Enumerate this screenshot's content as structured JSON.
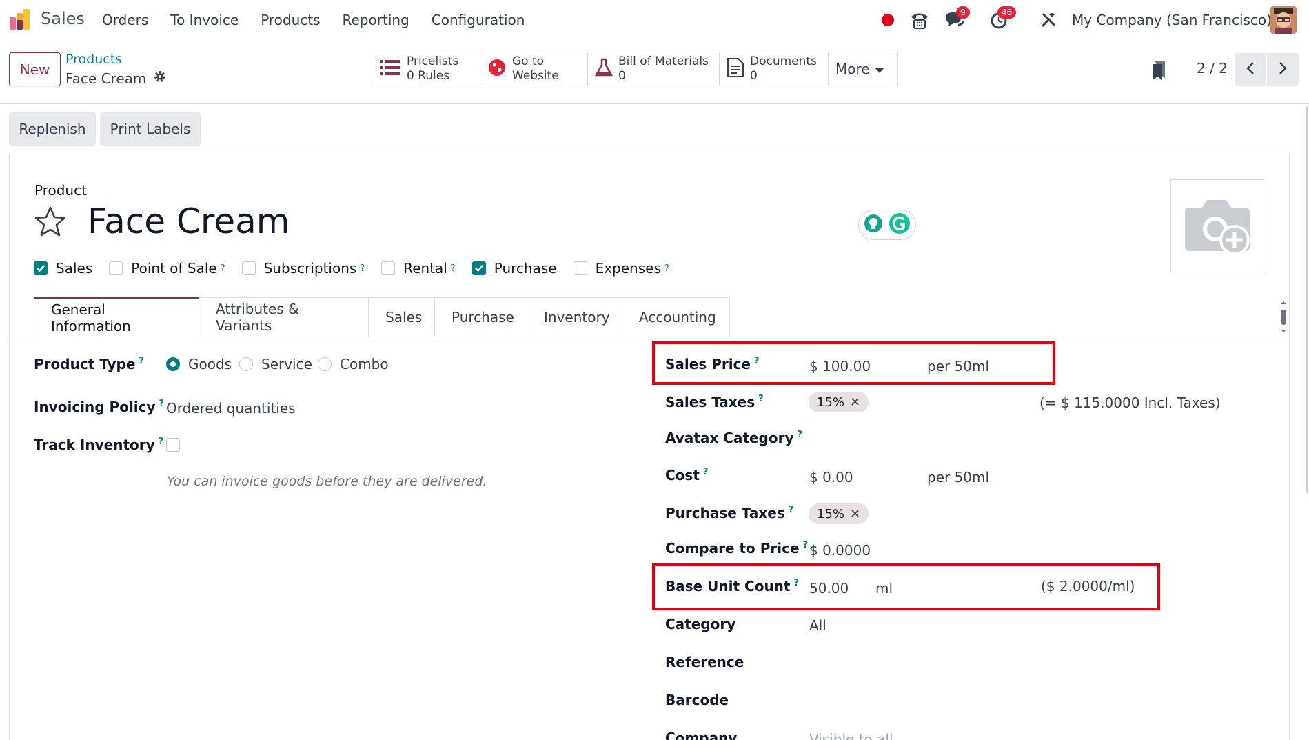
{
  "navbar": {
    "app_name": "Sales",
    "menu": [
      "Orders",
      "To Invoice",
      "Products",
      "Reporting",
      "Configuration"
    ],
    "chat_badge": "9",
    "activity_badge": "46",
    "company": "My Company (San Francisco)"
  },
  "control": {
    "new_label": "New",
    "breadcrumb_parent": "Products",
    "breadcrumb_current": "Face Cream",
    "smart_buttons": {
      "pricelists_title": "Pricelists",
      "pricelists_value": "0 Rules",
      "website_line1": "Go to",
      "website_line2": "Website",
      "bom_title": "Bill of Materials",
      "bom_value": "0",
      "documents_title": "Documents",
      "documents_value": "0",
      "more_label": "More"
    },
    "pager": "2 / 2"
  },
  "status_bar": {
    "replenish": "Replenish",
    "print_labels": "Print Labels"
  },
  "form": {
    "product_label": "Product",
    "title": "Face Cream",
    "checkboxes": {
      "sales": "Sales",
      "pos": "Point of Sale",
      "subscriptions": "Subscriptions",
      "rental": "Rental",
      "purchase": "Purchase",
      "expenses": "Expenses"
    },
    "tabs": [
      "General Information",
      "Attributes & Variants",
      "Sales",
      "Purchase",
      "Inventory",
      "Accounting"
    ],
    "left": {
      "product_type_label": "Product Type",
      "goods": "Goods",
      "service": "Service",
      "combo": "Combo",
      "invoicing_policy_label": "Invoicing Policy",
      "invoicing_policy_value": "Ordered quantities",
      "track_inventory_label": "Track Inventory",
      "hint": "You can invoice goods before they are delivered."
    },
    "right": {
      "sales_price_label": "Sales Price",
      "sales_price_value": "$ 100.00",
      "sales_price_uom": "per 50ml",
      "sales_taxes_label": "Sales Taxes",
      "sales_taxes_tag": "15%",
      "sales_taxes_incl": "(= $ 115.0000 Incl. Taxes)",
      "avatax_label": "Avatax Category",
      "cost_label": "Cost",
      "cost_value": "$ 0.00",
      "cost_uom": "per 50ml",
      "purchase_taxes_label": "Purchase Taxes",
      "purchase_taxes_tag": "15%",
      "compare_label": "Compare to Price",
      "compare_value": "$ 0.0000",
      "base_unit_label": "Base Unit Count",
      "base_unit_value": "50.00",
      "base_unit_uom": "ml",
      "base_unit_price": "($ 2.0000/ml)",
      "category_label": "Category",
      "category_value": "All",
      "reference_label": "Reference",
      "barcode_label": "Barcode",
      "company_label": "Company",
      "company_placeholder": "Visible to all"
    },
    "help_mark": "?"
  },
  "colors": {
    "brand": "#8a2f54",
    "teal": "#017e84",
    "highlight": "#e3000f"
  }
}
